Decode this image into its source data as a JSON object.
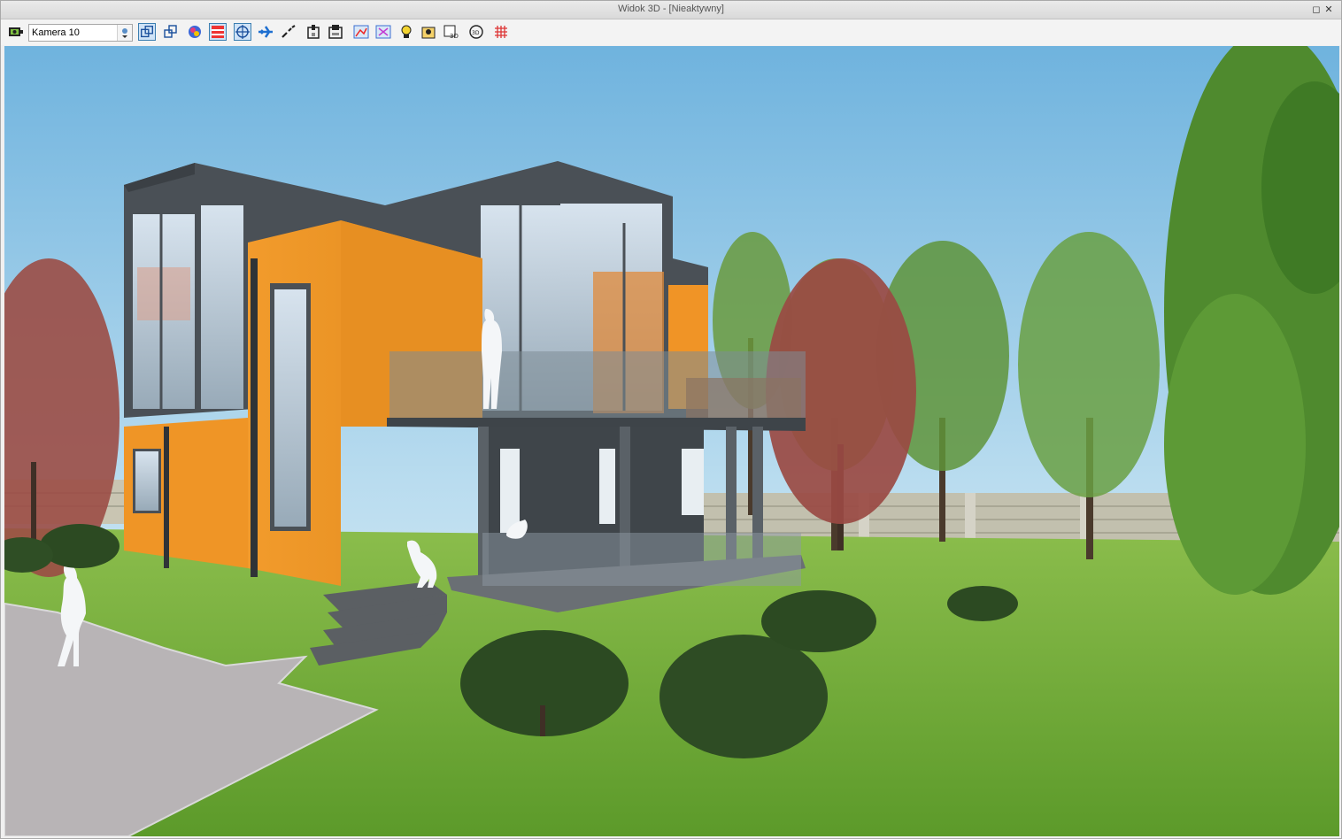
{
  "window": {
    "title": "Widok 3D - [Nieaktywny]",
    "restore_glyph": "◻",
    "close_glyph": "✕"
  },
  "toolbar": {
    "camera_select": {
      "value": "Kamera 10",
      "arrow_glyph": "▾"
    },
    "tools": [
      {
        "name": "camera-settings-icon",
        "active": false
      },
      {
        "name": "perspective-view-icon",
        "active": true
      },
      {
        "name": "axonometric-view-icon",
        "active": false
      },
      {
        "name": "color-render-icon",
        "active": false
      },
      {
        "name": "wall-layers-icon",
        "active": true
      },
      {
        "name": "orbit-icon",
        "active": true
      },
      {
        "name": "fly-mode-icon",
        "active": false
      },
      {
        "name": "walk-path-icon",
        "active": false
      },
      {
        "name": "section-box-icon",
        "active": false
      },
      {
        "name": "section-print-icon",
        "active": false
      },
      {
        "name": "render-settings-icon",
        "active": false
      },
      {
        "name": "materials-icon",
        "active": false
      },
      {
        "name": "light-settings-icon",
        "active": false
      },
      {
        "name": "texture-library-icon",
        "active": false
      },
      {
        "name": "export-3d-icon",
        "active": false
      },
      {
        "name": "rotate-3d-icon",
        "active": false
      },
      {
        "name": "grid-3d-icon",
        "active": false
      }
    ]
  },
  "viewport": {
    "description_colors": {
      "sky_top": "#6fb3de",
      "sky_bottom": "#dff0f7",
      "grass": "#5f9e2e",
      "facade_orange": "#f09426",
      "facade_gray": "#4f565c"
    }
  }
}
